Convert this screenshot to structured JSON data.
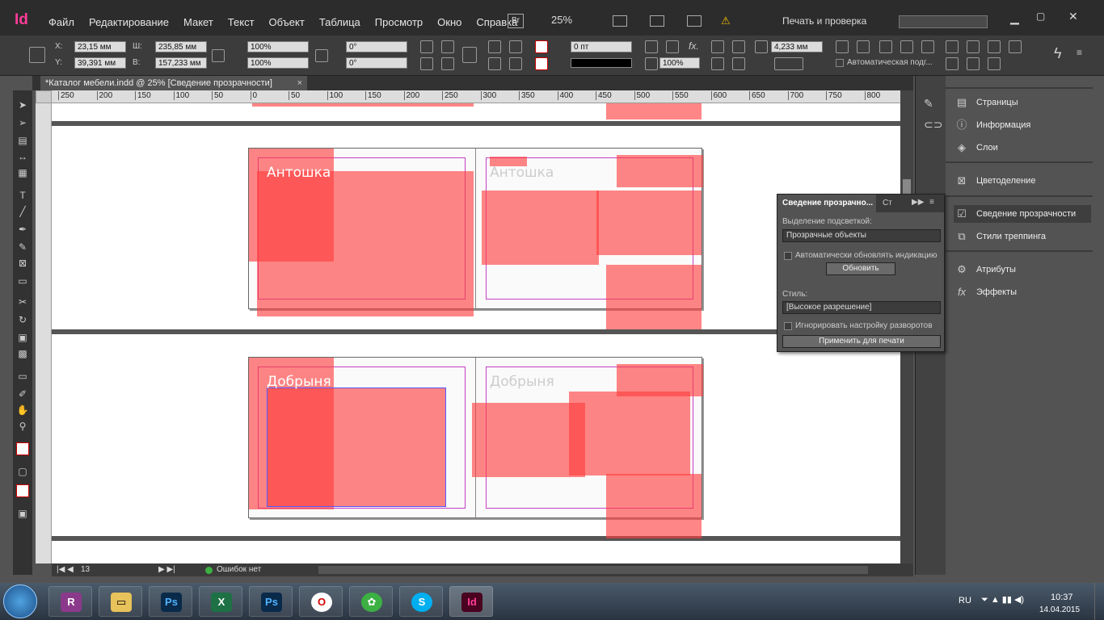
{
  "app": {
    "logo": "Id",
    "zoom": "25%",
    "mode": "Печать и проверка",
    "search_placeholder": ""
  },
  "menu": [
    "Файл",
    "Редактирование",
    "Макет",
    "Текст",
    "Объект",
    "Таблица",
    "Просмотр",
    "Окно",
    "Справка"
  ],
  "bridge": "Br",
  "control": {
    "x_label": "X:",
    "x": "23,15 мм",
    "y_label": "Y:",
    "y": "39,391 мм",
    "w_label": "Ш:",
    "w": "235,85 мм",
    "h_label": "В:",
    "h": "157,233 мм",
    "scale_x": "100%",
    "scale_y": "100%",
    "angle": "0°",
    "shear": "0°",
    "stroke": "0 пт",
    "opacity": "100%",
    "size": "4,233 мм",
    "auto_fit": "Автоматическая подг..."
  },
  "document": {
    "tab_title": "*Каталог мебели.indd @ 25% [Сведение прозрачности]",
    "close": "×"
  },
  "ruler": [
    "250",
    "200",
    "150",
    "100",
    "50",
    "0",
    "50",
    "100",
    "150",
    "200",
    "250",
    "300",
    "350",
    "400",
    "450",
    "500",
    "550",
    "600",
    "650",
    "700",
    "750",
    "800"
  ],
  "spreads": [
    {
      "title": "Антошка",
      "subtitle": "Антошка"
    },
    {
      "title": "Добрыня",
      "subtitle": "Добрыня"
    }
  ],
  "status": {
    "page": "13",
    "errors": "Ошибок нет"
  },
  "panels": [
    {
      "label": "Страницы",
      "icon": "pages-icon"
    },
    {
      "label": "Информация",
      "icon": "info-icon"
    },
    {
      "label": "Слои",
      "icon": "layers-icon"
    },
    {
      "label": "Цветоделение",
      "icon": "separations-icon"
    },
    {
      "label": "Сведение прозрачности",
      "icon": "flattener-icon"
    },
    {
      "label": "Стили треппинга",
      "icon": "trap-icon"
    },
    {
      "label": "Атрибуты",
      "icon": "attributes-icon"
    },
    {
      "label": "Эффекты",
      "icon": "effects-icon"
    }
  ],
  "flattener": {
    "tab1": "Сведение прозрачно...",
    "tab2": "Ст",
    "highlight_label": "Выделение подсветкой:",
    "highlight_value": "Прозрачные объекты",
    "auto_refresh": "Автоматически обновлять индикацию",
    "refresh": "Обновить",
    "style_label": "Стиль:",
    "style_value": "[Высокое разрешение]",
    "ignore": "Игнорировать настройку разворотов",
    "apply": "Применить для печати"
  },
  "taskbar": {
    "lang": "RU",
    "time": "10:37",
    "date": "14.04.2015"
  },
  "colors": {
    "accent": "#ff3c9a",
    "highlight": "#ff3c3c"
  }
}
